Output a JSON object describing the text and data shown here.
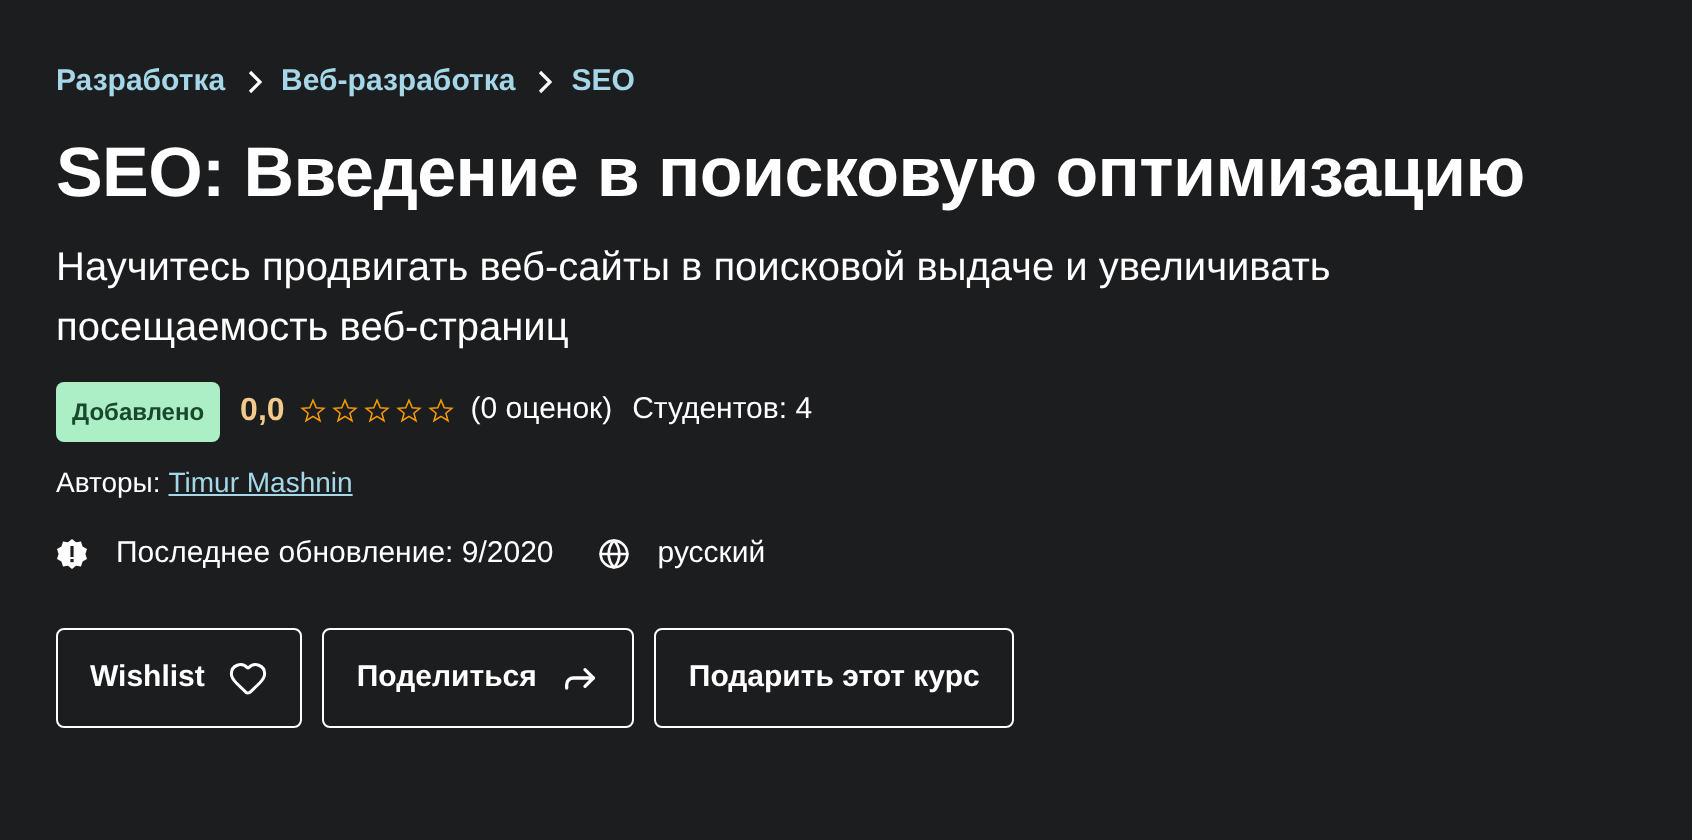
{
  "breadcrumbs": [
    {
      "label": "Разработка"
    },
    {
      "label": "Веб-разработка"
    },
    {
      "label": "SEO"
    }
  ],
  "title": "SEO: Введение в поисковую оптимизацию",
  "subtitle": "Научитесь продвигать веб-сайты в поисковой выдаче и увеличивать посещаемость веб-страниц",
  "badge": "Добавлено",
  "rating": {
    "value": "0,0",
    "stars": 0,
    "count": "(0 оценок)"
  },
  "students": "Студентов: 4",
  "authors_label": "Авторы:",
  "author": "Timur Mashnin",
  "updated": "Последнее обновление: 9/2020",
  "language": "русский",
  "buttons": [
    {
      "label": "Wishlist",
      "kind": "heart"
    },
    {
      "label": "Поделиться",
      "kind": "share"
    },
    {
      "label": "Подарить этот курс",
      "kind": "plain"
    }
  ]
}
